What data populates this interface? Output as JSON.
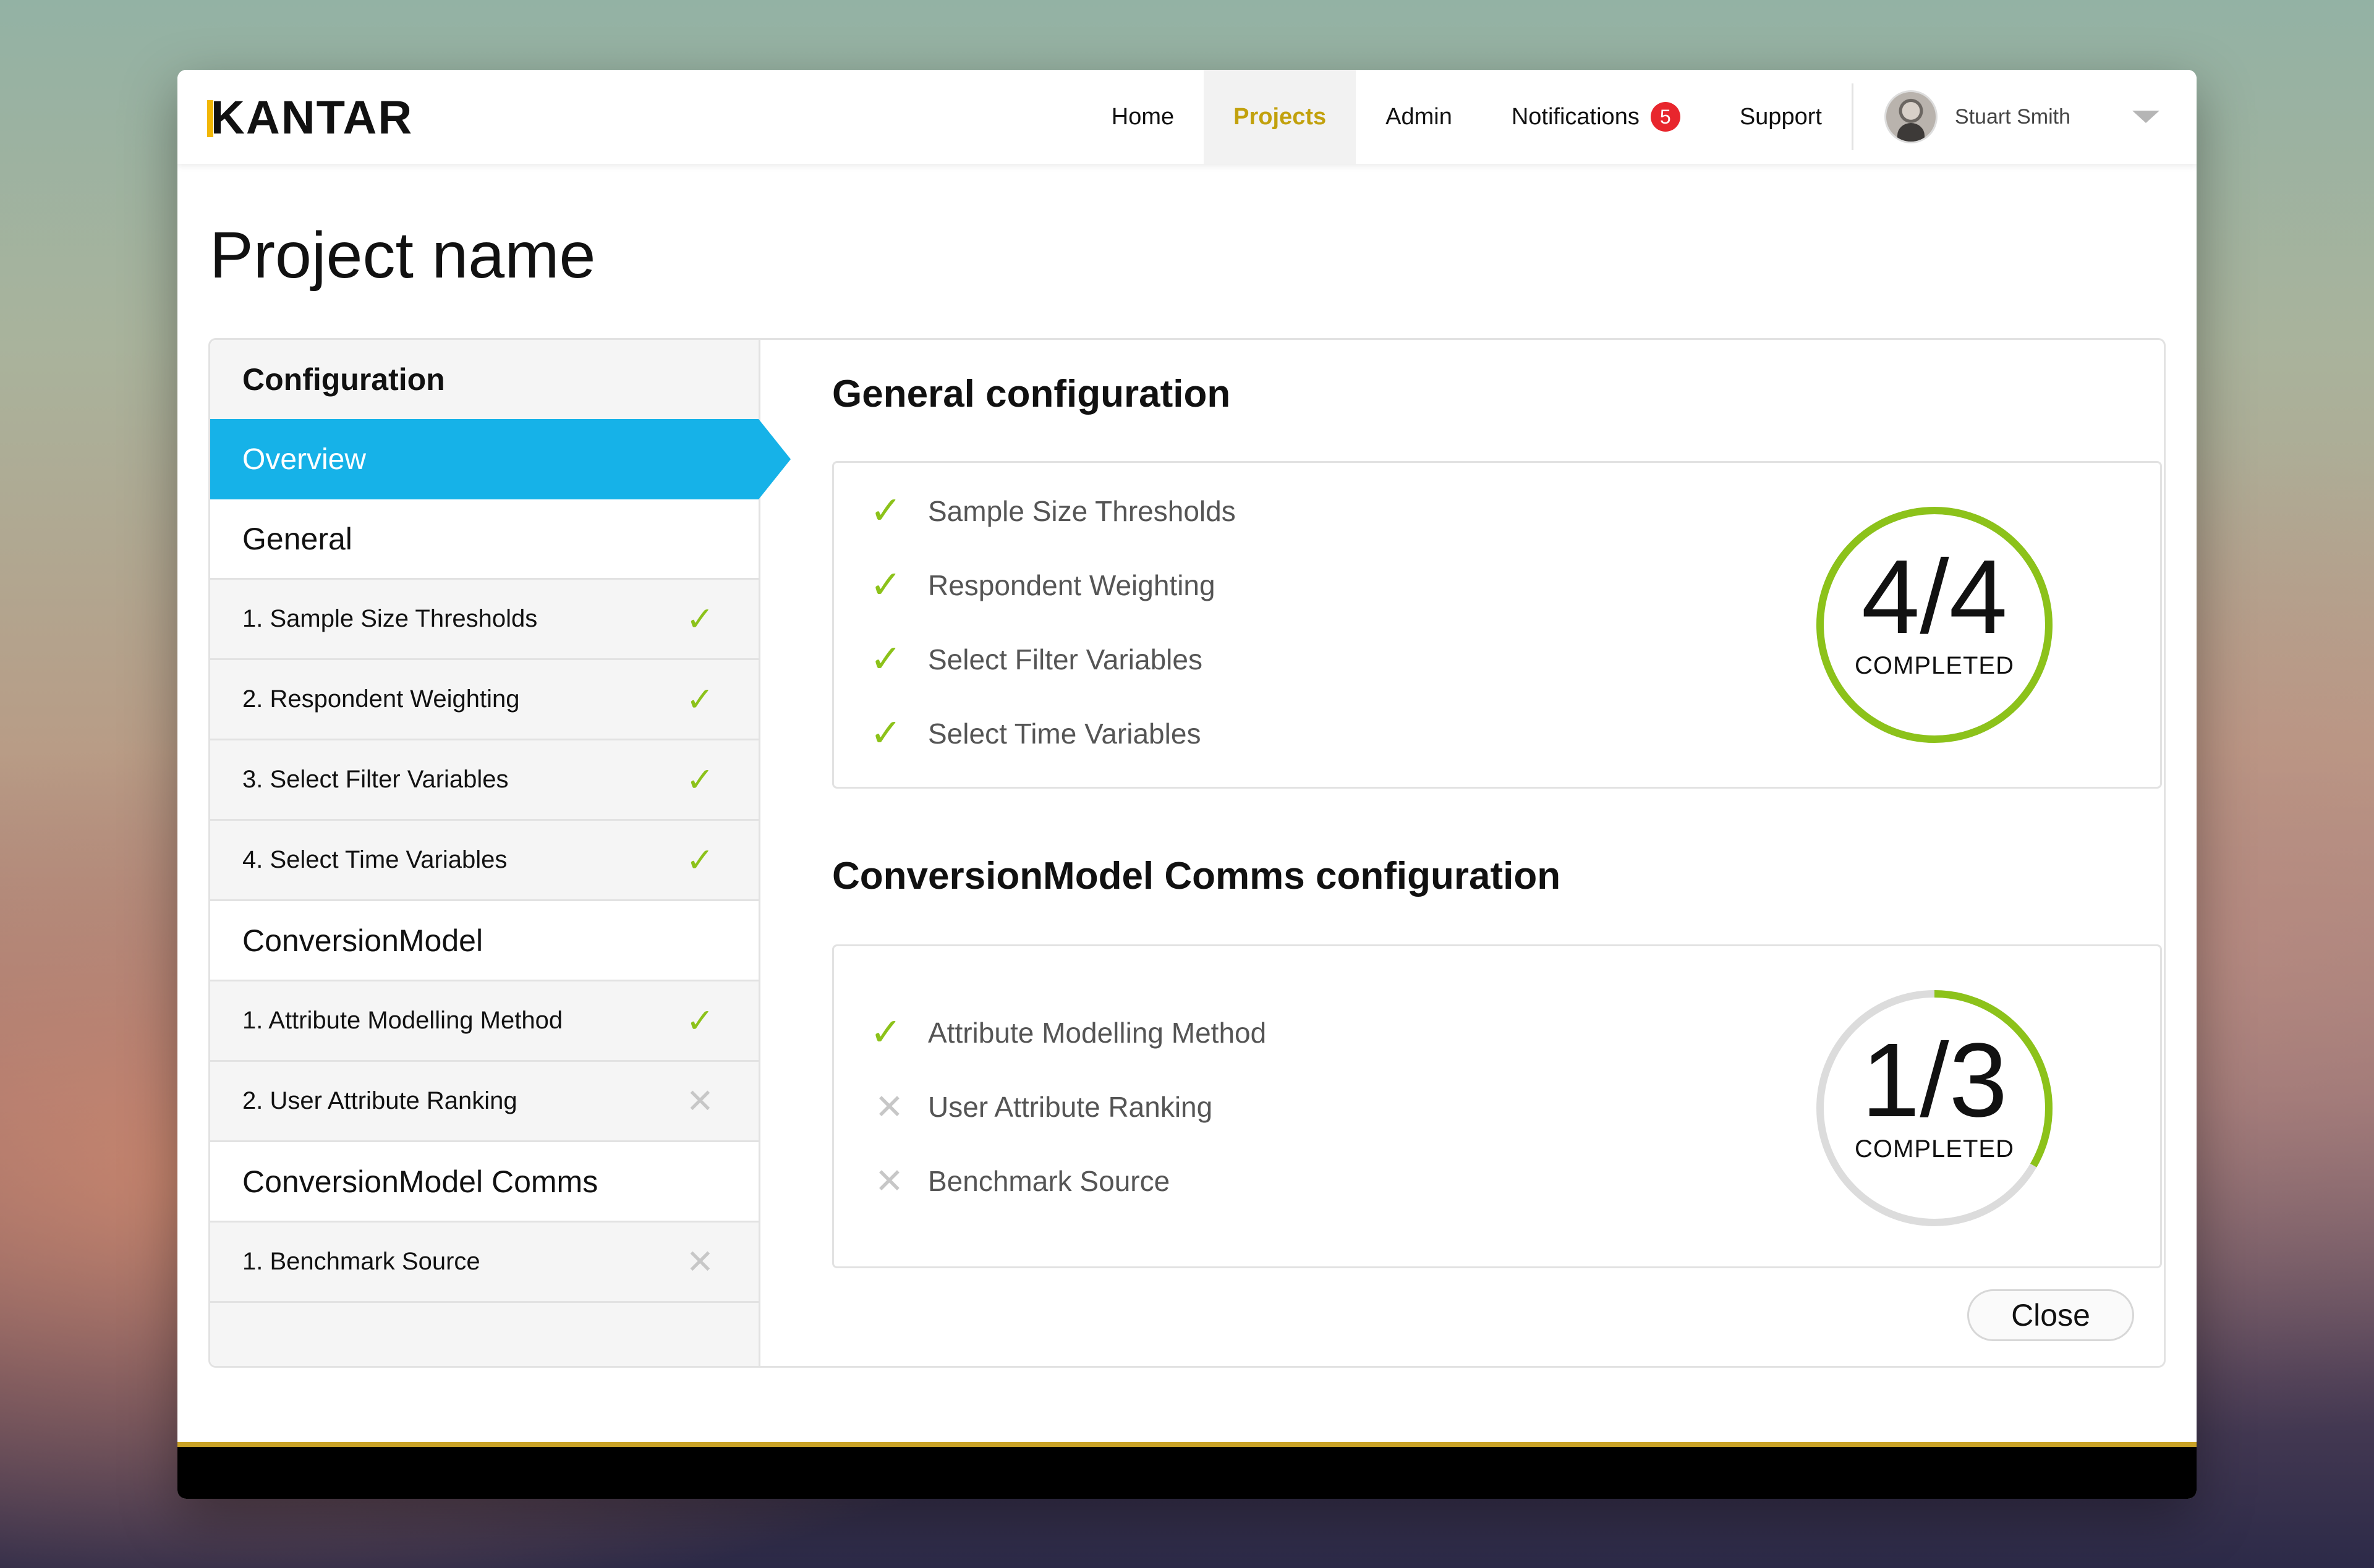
{
  "brand": {
    "logo_text": "KANTAR",
    "accent_color": "#f2b705"
  },
  "nav": {
    "items": [
      {
        "label": "Home"
      },
      {
        "label": "Projects"
      },
      {
        "label": "Admin"
      },
      {
        "label": "Notifications"
      },
      {
        "label": "Support"
      }
    ],
    "notifications_count": "5",
    "user_name": "Stuart Smith"
  },
  "page": {
    "title": "Project name"
  },
  "sidebar": {
    "heading": "Configuration",
    "overview": "Overview",
    "groups": [
      {
        "label": "General"
      },
      {
        "label": "ConversionModel"
      },
      {
        "label": "ConversionModel Comms"
      }
    ],
    "items": [
      {
        "label": "1. Sample Size Thresholds",
        "done": true
      },
      {
        "label": "2. Respondent Weighting",
        "done": true
      },
      {
        "label": "3. Select Filter Variables",
        "done": true
      },
      {
        "label": "4. Select Time Variables",
        "done": true
      },
      {
        "label": "1. Attribute Modelling Method",
        "done": true
      },
      {
        "label": "2. User Attribute Ranking",
        "done": false
      },
      {
        "label": "1. Benchmark Source",
        "done": false
      }
    ]
  },
  "sections": [
    {
      "title": "General configuration",
      "items": [
        {
          "label": "Sample Size Thresholds",
          "done": true
        },
        {
          "label": "Respondent Weighting",
          "done": true
        },
        {
          "label": "Select Filter Variables",
          "done": true
        },
        {
          "label": "Select Time Variables",
          "done": true
        }
      ],
      "progress": {
        "text": "4/4",
        "label": "COMPLETED",
        "fraction": 1.0
      }
    },
    {
      "title": "ConversionModel Comms configuration",
      "items": [
        {
          "label": "Attribute Modelling Method",
          "done": true
        },
        {
          "label": "User Attribute Ranking",
          "done": false
        },
        {
          "label": "Benchmark Source",
          "done": false
        }
      ],
      "progress": {
        "text": "1/3",
        "label": "COMPLETED",
        "fraction": 0.3333
      }
    }
  ],
  "icons": {
    "done": "check-icon",
    "not_done": "cross-icon"
  },
  "colors": {
    "overview_bg": "#16b2e8",
    "check": "#8cc21a",
    "cross": "#c7c7c7",
    "ring_done": "#8cc21a",
    "ring_track": "#dcdcdc",
    "badge": "#e8262d",
    "active_nav": "#c2a10d"
  },
  "actions": {
    "close_label": "Close"
  }
}
